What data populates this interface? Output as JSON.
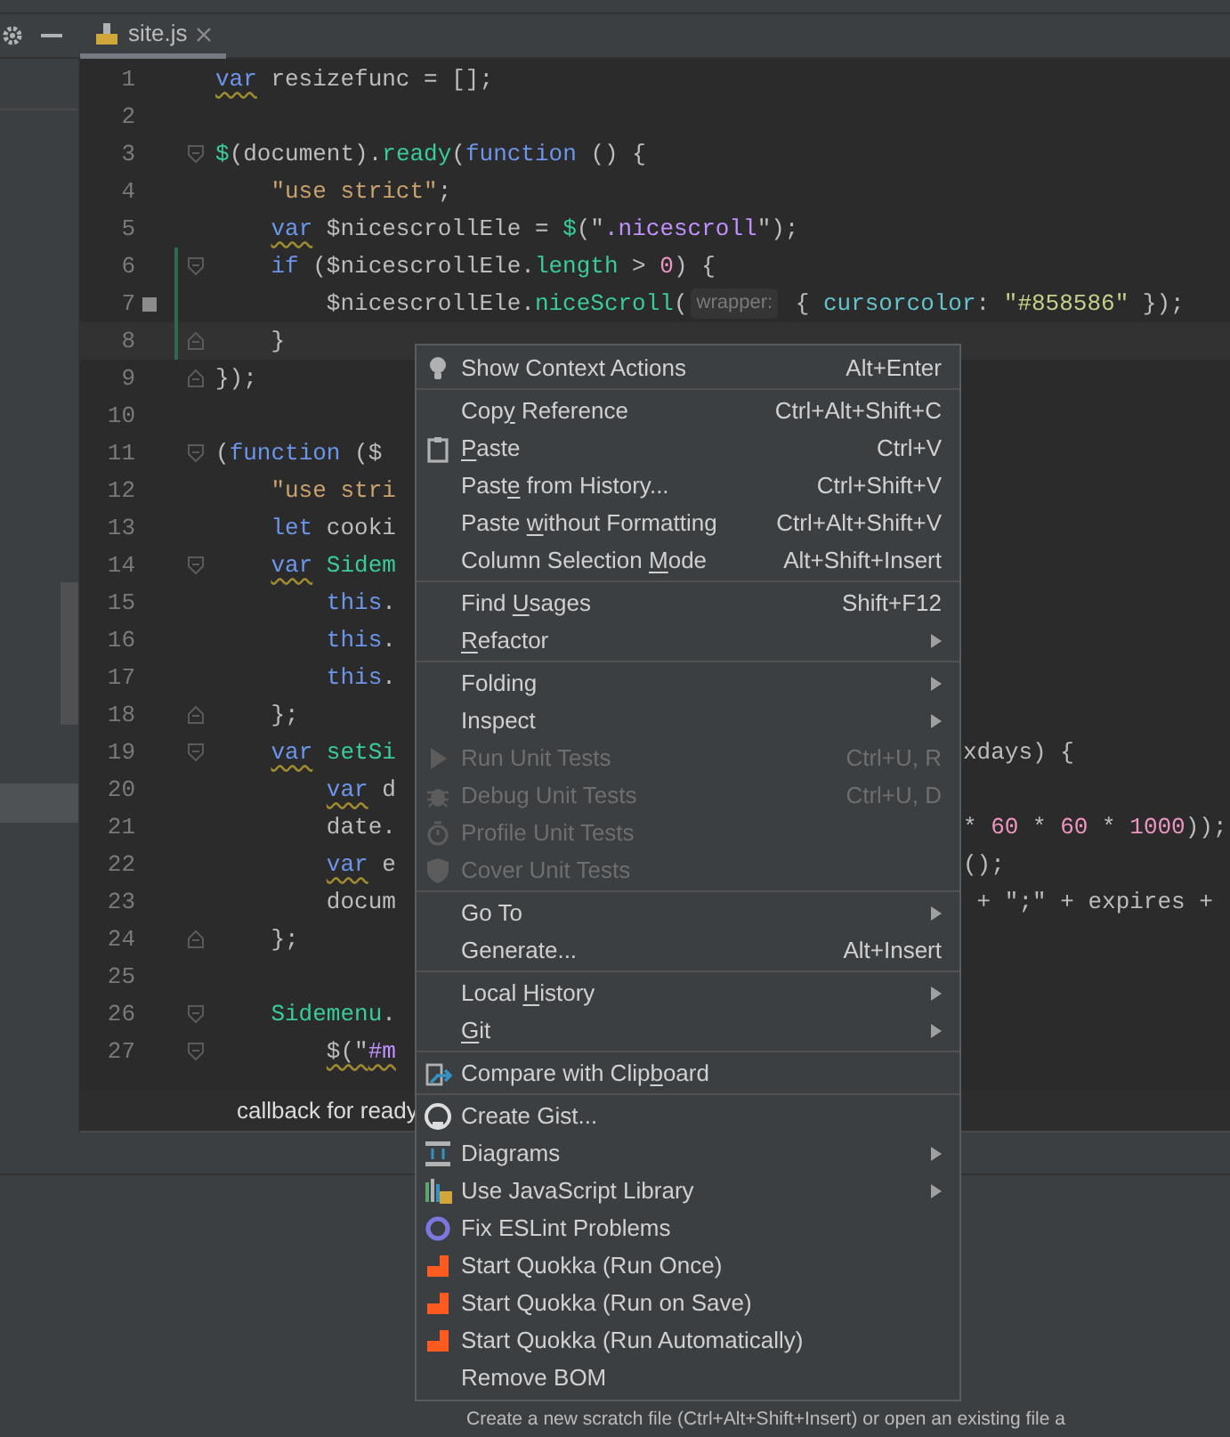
{
  "editor_tab": {
    "label": "site.js",
    "selected": true
  },
  "code": [
    {
      "number": "1",
      "tokens": [
        {
          "text": "var",
          "kind": "keyword",
          "warn": true
        },
        {
          "text": " resizefunc = [];",
          "kind": "plain"
        }
      ]
    },
    {
      "number": "2"
    },
    {
      "number": "3",
      "kind": "fold_start",
      "tokens": [
        {
          "text": "$",
          "kind": "function"
        },
        {
          "text": "(document).",
          "kind": "plain"
        },
        {
          "text": "ready",
          "kind": "function"
        },
        {
          "text": "(",
          "kind": "plain"
        },
        {
          "text": "function",
          "kind": "keyword"
        },
        {
          "text": " () {",
          "kind": "plain"
        }
      ]
    },
    {
      "number": "4",
      "tokens": [
        {
          "text": "    \"use strict\"",
          "kind": "string"
        },
        {
          "text": ";",
          "kind": "plain"
        }
      ]
    },
    {
      "number": "5",
      "tokens": [
        {
          "text": "    var",
          "kind": "keyword",
          "warn": true
        },
        {
          "text": " $nicescrollEle = ",
          "kind": "plain"
        },
        {
          "text": "$",
          "kind": "function"
        },
        {
          "text": "(\"",
          "kind": "plain"
        },
        {
          "text": ".nicescroll",
          "kind": "selector"
        },
        {
          "text": "\");",
          "kind": "plain"
        }
      ]
    },
    {
      "number": "6",
      "kind": "fold_start",
      "changed": true,
      "tokens": [
        {
          "text": "    if",
          "kind": "keyword"
        },
        {
          "text": " ($nicescrollEle.",
          "kind": "plain"
        },
        {
          "text": "length",
          "kind": "function"
        },
        {
          "text": " > ",
          "kind": "plain"
        },
        {
          "text": "0",
          "kind": "number"
        },
        {
          "text": ") {",
          "kind": "plain"
        }
      ]
    },
    {
      "number": "7",
      "changed": true,
      "bookmark": true,
      "tokens": [
        {
          "text": "        $nicescrollEle.",
          "kind": "plain"
        },
        {
          "text": "niceScroll",
          "kind": "function"
        },
        {
          "text": "(",
          "kind": "plain"
        },
        {
          "text": "wrapper:",
          "kind": "hint"
        },
        {
          "text": " { ",
          "kind": "plain"
        },
        {
          "text": "cursorcolor",
          "kind": "property"
        },
        {
          "text": ": ",
          "kind": "plain"
        },
        {
          "text": "\"#858586\"",
          "kind": "color_string"
        },
        {
          "text": " });",
          "kind": "plain"
        }
      ]
    },
    {
      "number": "8",
      "kind": "fold_end",
      "changed": true,
      "current": true,
      "tokens": [
        {
          "text": "    }",
          "kind": "plain"
        }
      ]
    },
    {
      "number": "9",
      "kind": "fold_end",
      "tokens": [
        {
          "text": "});",
          "kind": "plain"
        }
      ]
    },
    {
      "number": "10"
    },
    {
      "number": "11",
      "kind": "fold_start",
      "tokens": [
        {
          "text": "(",
          "kind": "plain"
        },
        {
          "text": "function",
          "kind": "keyword"
        },
        {
          "text": " ($",
          "kind": "plain"
        }
      ]
    },
    {
      "number": "12",
      "tokens": [
        {
          "text": "    \"use stri",
          "kind": "string"
        }
      ]
    },
    {
      "number": "13",
      "tokens": [
        {
          "text": "    let",
          "kind": "keyword"
        },
        {
          "text": " cooki",
          "kind": "plain"
        }
      ]
    },
    {
      "number": "14",
      "kind": "fold_start",
      "tokens": [
        {
          "text": "    var",
          "kind": "keyword",
          "warn": true
        },
        {
          "text": " Sidem",
          "kind": "function"
        }
      ]
    },
    {
      "number": "15",
      "tokens": [
        {
          "text": "        this",
          "kind": "keyword"
        },
        {
          "text": ".",
          "kind": "plain"
        }
      ]
    },
    {
      "number": "16",
      "tokens": [
        {
          "text": "        this",
          "kind": "keyword"
        },
        {
          "text": ".",
          "kind": "plain"
        }
      ]
    },
    {
      "number": "17",
      "tokens": [
        {
          "text": "        this",
          "kind": "keyword"
        },
        {
          "text": ".",
          "kind": "plain"
        }
      ]
    },
    {
      "number": "18",
      "kind": "fold_end",
      "tokens": [
        {
          "text": "    };",
          "kind": "plain"
        }
      ]
    },
    {
      "number": "19",
      "kind": "fold_start",
      "tokens": [
        {
          "text": "    var",
          "kind": "keyword",
          "warn": true
        },
        {
          "text": " setSi",
          "kind": "function"
        }
      ],
      "right": [
        {
          "text": "xdays) {",
          "kind": "plain"
        }
      ]
    },
    {
      "number": "20",
      "tokens": [
        {
          "text": "        var",
          "kind": "keyword",
          "warn": true
        },
        {
          "text": " d",
          "kind": "plain"
        }
      ]
    },
    {
      "number": "21",
      "tokens": [
        {
          "text": "        date.",
          "kind": "plain"
        }
      ],
      "right": [
        {
          "text": "* ",
          "kind": "plain"
        },
        {
          "text": "60",
          "kind": "number"
        },
        {
          "text": " * ",
          "kind": "plain"
        },
        {
          "text": "60",
          "kind": "number"
        },
        {
          "text": " * ",
          "kind": "plain"
        },
        {
          "text": "1000",
          "kind": "number"
        },
        {
          "text": "));",
          "kind": "plain"
        }
      ]
    },
    {
      "number": "22",
      "tokens": [
        {
          "text": "        var",
          "kind": "keyword",
          "warn": true
        },
        {
          "text": " e",
          "kind": "plain"
        }
      ],
      "right": [
        {
          "text": "();",
          "kind": "plain"
        }
      ]
    },
    {
      "number": "23",
      "tokens": [
        {
          "text": "        docum",
          "kind": "plain"
        }
      ],
      "right": [
        {
          "text": " + \";\" + expires +",
          "kind": "plain"
        }
      ]
    },
    {
      "number": "24",
      "kind": "fold_end",
      "tokens": [
        {
          "text": "    };",
          "kind": "plain"
        }
      ]
    },
    {
      "number": "25"
    },
    {
      "number": "26",
      "kind": "fold_start",
      "tokens": [
        {
          "text": "    Sidemenu",
          "kind": "function"
        },
        {
          "text": ".",
          "kind": "plain"
        }
      ]
    },
    {
      "number": "27",
      "kind": "fold_start",
      "tokens": [
        {
          "text": "        $(\"",
          "kind": "plain",
          "warn": true
        },
        {
          "text": "#m",
          "kind": "selector",
          "warn": true
        }
      ]
    }
  ],
  "hint_bar": {
    "text": "callback for ready"
  },
  "context_menu": {
    "groups": [
      [
        {
          "label": "Show Context Actions",
          "kind": "bulb",
          "shortcut": "Alt+Enter",
          "disabled": false
        }
      ],
      [
        {
          "label_start": "Cop",
          "mnemonic": "y",
          "label_end": " Reference",
          "shortcut": "Ctrl+Alt+Shift+C",
          "disabled": false
        },
        {
          "mnemonic": "P",
          "label_end": "aste",
          "kind": "clipboard",
          "shortcut": "Ctrl+V",
          "disabled": false
        },
        {
          "label_start": "Past",
          "mnemonic": "e",
          "label_end": " from History...",
          "shortcut": "Ctrl+Shift+V",
          "disabled": false
        },
        {
          "label_start": "Paste ",
          "mnemonic": "w",
          "label_end": "ithout Formatting",
          "shortcut": "Ctrl+Alt+Shift+V",
          "disabled": false
        },
        {
          "label_start": "Column Selection ",
          "mnemonic": "M",
          "label_end": "ode",
          "shortcut": "Alt+Shift+Insert",
          "disabled": false
        }
      ],
      [
        {
          "label_start": "Find ",
          "mnemonic": "U",
          "label_end": "sages",
          "shortcut": "Shift+F12",
          "disabled": false
        },
        {
          "mnemonic": "R",
          "label_end": "efactor",
          "submenu": true,
          "disabled": false
        }
      ],
      [
        {
          "label": "Folding",
          "submenu": true,
          "disabled": false
        },
        {
          "label": "Inspect",
          "submenu": true,
          "disabled": false
        },
        {
          "label": "Run Unit Tests",
          "kind": "run",
          "shortcut": "Ctrl+U, R",
          "disabled": true
        },
        {
          "label": "Debug Unit Tests",
          "kind": "debug",
          "shortcut": "Ctrl+U, D",
          "disabled": true
        },
        {
          "label": "Profile Unit Tests",
          "kind": "profile",
          "disabled": true
        },
        {
          "label": "Cover Unit Tests",
          "kind": "coverage",
          "disabled": true
        }
      ],
      [
        {
          "label": "Go To",
          "submenu": true,
          "disabled": false
        },
        {
          "label": "Generate...",
          "shortcut": "Alt+Insert",
          "disabled": false
        }
      ],
      [
        {
          "label_start": "Local ",
          "mnemonic": "H",
          "label_end": "istory",
          "submenu": true,
          "disabled": false
        },
        {
          "mnemonic": "G",
          "label_end": "it",
          "submenu": true,
          "disabled": false
        }
      ],
      [
        {
          "label_start": "Compare with Clip",
          "mnemonic": "b",
          "label_end": "oard",
          "kind": "compare",
          "disabled": false
        }
      ],
      [
        {
          "label": "Create Gist...",
          "kind": "gist",
          "disabled": false
        },
        {
          "label": "Diagrams",
          "kind": "diagram",
          "submenu": true,
          "disabled": false
        },
        {
          "label": "Use JavaScript Library",
          "kind": "library",
          "submenu": true,
          "disabled": false
        },
        {
          "label": "Fix ESLint Problems",
          "kind": "lint",
          "disabled": false
        },
        {
          "label": "Start Quokka (Run Once)",
          "kind": "quokka",
          "disabled": false
        },
        {
          "label": "Start Quokka (Run on Save)",
          "kind": "quokka",
          "disabled": false
        },
        {
          "label": "Start Quokka (Run Automatically)",
          "kind": "quokka",
          "disabled": false
        },
        {
          "label": "Remove BOM",
          "disabled": false
        }
      ]
    ]
  },
  "status_text": "Create a new scratch file (Ctrl+Alt+Shift+Insert) or open an existing file a"
}
